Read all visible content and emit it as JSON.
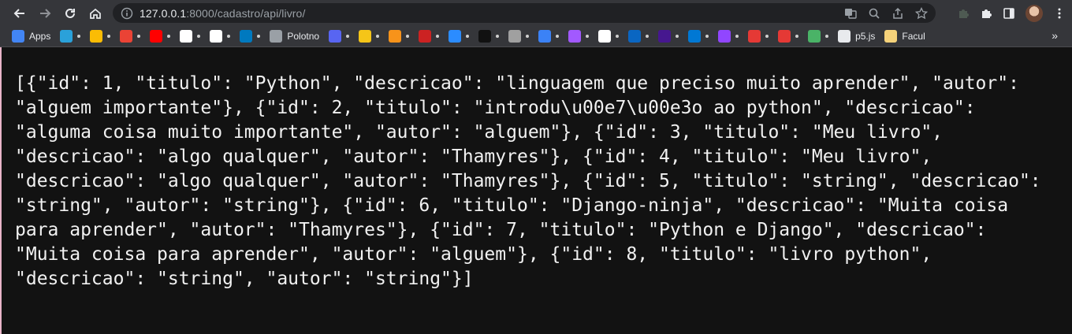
{
  "browser": {
    "url_host": "127.0.0.1",
    "url_path": ":8000/cadastro/api/livro/"
  },
  "bookmarks": [
    {
      "label": "Apps",
      "icon": "apps-grid-icon",
      "color": "#4285f4"
    },
    {
      "label": "",
      "icon": "telegram-icon",
      "color": "#2aa1da"
    },
    {
      "label": "",
      "icon": "google-drive-icon",
      "color": "#fbbc04"
    },
    {
      "label": "",
      "icon": "gmail-icon",
      "color": "#ea4335"
    },
    {
      "label": "",
      "icon": "youtube-icon",
      "color": "#ff0000"
    },
    {
      "label": "",
      "icon": "google-icon",
      "color": "#ffffff"
    },
    {
      "label": "",
      "icon": "github-icon",
      "color": "#ffffff"
    },
    {
      "label": "",
      "icon": "trello-icon",
      "color": "#0079bf"
    },
    {
      "label": "Polotno",
      "icon": "polotno-icon",
      "color": "#9aa0a6"
    },
    {
      "label": "",
      "icon": "discord-icon",
      "color": "#5865f2"
    },
    {
      "label": "",
      "icon": "star-icon",
      "color": "#f5c518"
    },
    {
      "label": "",
      "icon": "bitcoin-icon",
      "color": "#f7931a"
    },
    {
      "label": "",
      "icon": "bookmark-icon",
      "color": "#cc2222"
    },
    {
      "label": "",
      "icon": "droplet-icon",
      "color": "#2b8cff"
    },
    {
      "label": "",
      "icon": "alura-icon",
      "color": "#111111"
    },
    {
      "label": "",
      "icon": "alura-icon",
      "color": "#a0a0a0"
    },
    {
      "label": "",
      "icon": "alura-icon",
      "color": "#3b82f6"
    },
    {
      "label": "",
      "icon": "figma-icon",
      "color": "#a259ff"
    },
    {
      "label": "",
      "icon": "notion-icon",
      "color": "#ffffff"
    },
    {
      "label": "",
      "icon": "linkedin-icon",
      "color": "#0a66c2"
    },
    {
      "label": "",
      "icon": "kahoot-icon",
      "color": "#46178f"
    },
    {
      "label": "",
      "icon": "outlook-icon",
      "color": "#0078d4"
    },
    {
      "label": "",
      "icon": "twitch-icon",
      "color": "#9146ff"
    },
    {
      "label": "",
      "icon": "heart-icon",
      "color": "#e53935"
    },
    {
      "label": "",
      "icon": "target-icon",
      "color": "#e53935"
    },
    {
      "label": "",
      "icon": "pushbullet-icon",
      "color": "#4ab367"
    },
    {
      "label": "p5.js",
      "icon": "globe-icon",
      "color": "#e8eaed"
    },
    {
      "label": "Facul",
      "icon": "folder-icon",
      "color": "#f5d27a"
    }
  ],
  "content": {
    "json_text": "[{\"id\": 1, \"titulo\": \"Python\", \"descricao\": \"linguagem que preciso muito aprender\", \"autor\": \"alguem importante\"}, {\"id\": 2, \"titulo\": \"introdu\\u00e7\\u00e3o ao python\", \"descricao\": \"alguma coisa muito importante\", \"autor\": \"alguem\"}, {\"id\": 3, \"titulo\": \"Meu livro\", \"descricao\": \"algo qualquer\", \"autor\": \"Thamyres\"}, {\"id\": 4, \"titulo\": \"Meu livro\", \"descricao\": \"algo qualquer\", \"autor\": \"Thamyres\"}, {\"id\": 5, \"titulo\": \"string\", \"descricao\": \"string\", \"autor\": \"string\"}, {\"id\": 6, \"titulo\": \"Django-ninja\", \"descricao\": \"Muita coisa para aprender\", \"autor\": \"Thamyres\"}, {\"id\": 7, \"titulo\": \"Python e Django\", \"descricao\": \"Muita coisa para aprender\", \"autor\": \"alguem\"}, {\"id\": 8, \"titulo\": \"livro python\", \"descricao\": \"string\", \"autor\": \"string\"}]"
  }
}
